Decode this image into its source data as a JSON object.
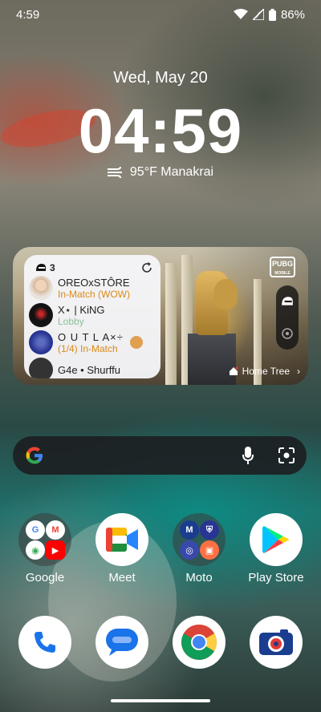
{
  "status_bar": {
    "time": "4:59",
    "battery": "86%"
  },
  "lockscreen": {
    "date": "Wed, May 20",
    "clock": "04:59",
    "weather": "95°F Manakrai"
  },
  "widget": {
    "friend_count": "3",
    "friends": [
      {
        "name": "OREOxSTÔRE",
        "status": "In-Match (WOW)",
        "status_color": "#d98a1a"
      },
      {
        "name": "X⋆ | KiNG",
        "status": "Lobby",
        "status_color": "#2e9e4d"
      },
      {
        "name": "O U T L A×÷",
        "status": "(1/4) In-Match",
        "status_color": "#d98a1a"
      },
      {
        "name": "G4e • Shurffu",
        "status": "",
        "status_color": "#2e9e4d"
      }
    ],
    "brand": "PUBG",
    "brand_sub": "MOBILE",
    "home_label": "Home Tree"
  },
  "apps_row1": [
    {
      "label": "Google",
      "icon": "google-folder-icon"
    },
    {
      "label": "Meet",
      "icon": "meet-icon"
    },
    {
      "label": "Moto",
      "icon": "moto-folder-icon"
    },
    {
      "label": "Play Store",
      "icon": "play-store-icon"
    }
  ],
  "dock": [
    {
      "icon": "phone-icon"
    },
    {
      "icon": "messages-icon"
    },
    {
      "icon": "chrome-icon"
    },
    {
      "icon": "camera-icon"
    }
  ],
  "colors": {
    "accent_orange": "#d98a1a",
    "accent_green": "#2e9e4d",
    "search_bg": "#1c2022"
  }
}
